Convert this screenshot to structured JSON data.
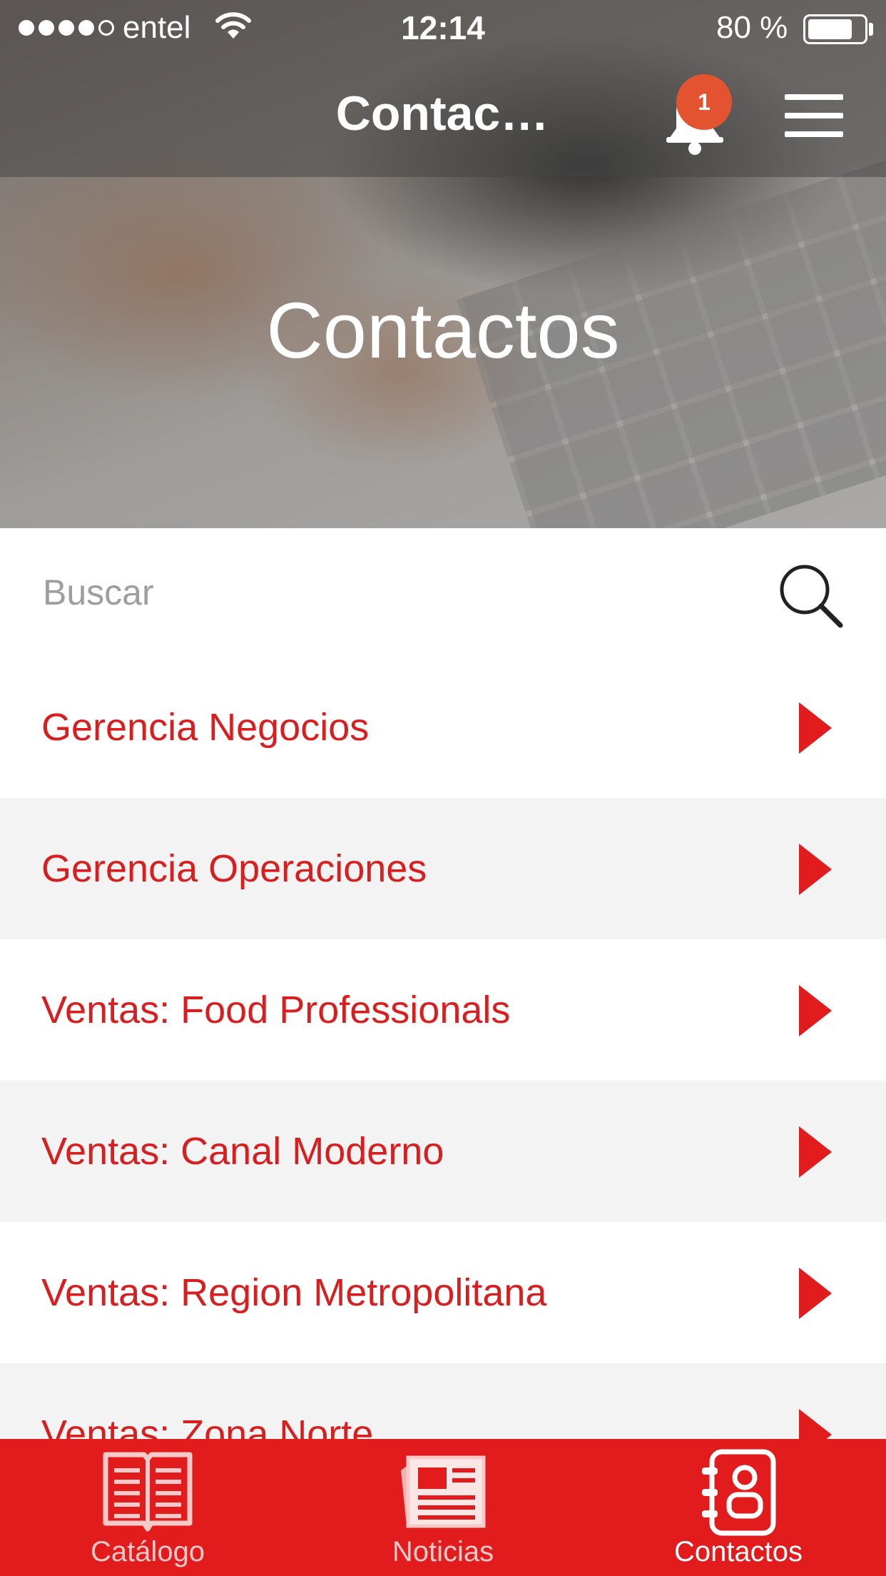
{
  "status_bar": {
    "carrier": "entel",
    "time": "12:14",
    "battery": "80 %",
    "battery_level": 0.8,
    "signal_bars": 4,
    "signal_total": 5
  },
  "nav": {
    "title": "Contac…",
    "notification_count": "1"
  },
  "hero": {
    "title": "Contactos"
  },
  "search": {
    "placeholder": "Buscar",
    "value": ""
  },
  "list": {
    "items": [
      {
        "label": "Gerencia Negocios"
      },
      {
        "label": "Gerencia Operaciones"
      },
      {
        "label": "Ventas: Food Professionals"
      },
      {
        "label": "Ventas: Canal Moderno"
      },
      {
        "label": "Ventas: Region Metropolitana"
      },
      {
        "label": "Ventas: Zona Norte"
      }
    ]
  },
  "tabs": [
    {
      "label": "Catálogo",
      "icon": "book-icon",
      "active": false
    },
    {
      "label": "Noticias",
      "icon": "newspaper-icon",
      "active": false
    },
    {
      "label": "Contactos",
      "icon": "contacts-book-icon",
      "active": true
    }
  ],
  "colors": {
    "accent": "#e21c1c",
    "list_text": "#d81e1e",
    "badge": "#e4532f",
    "alt_row": "#f3f3f3"
  }
}
